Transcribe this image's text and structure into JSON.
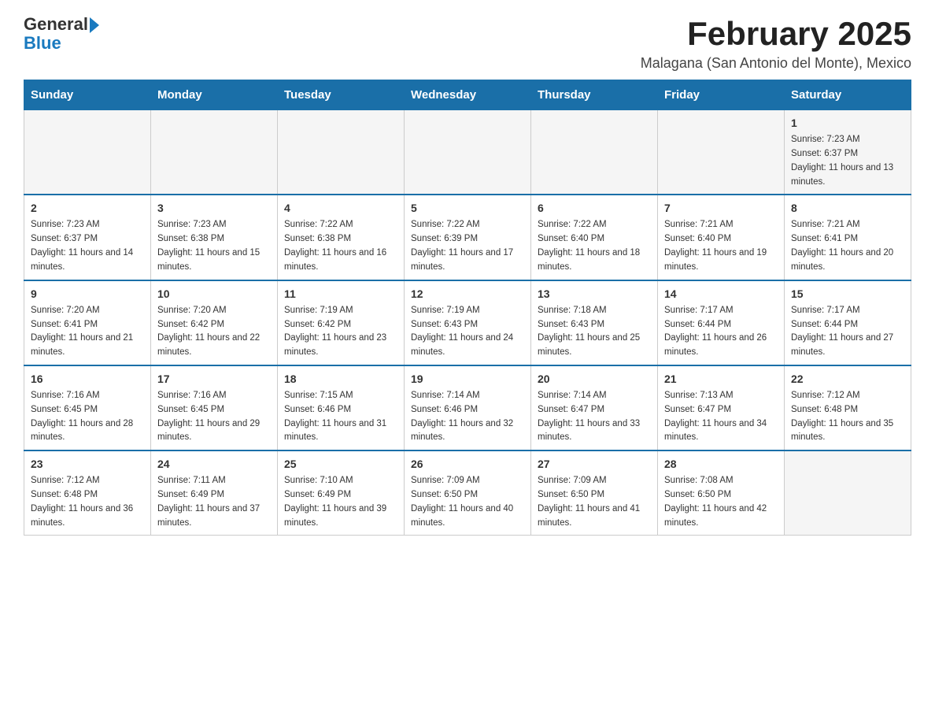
{
  "header": {
    "logo_general": "General",
    "logo_blue": "Blue",
    "month_title": "February 2025",
    "subtitle": "Malagana (San Antonio del Monte), Mexico"
  },
  "days_of_week": [
    "Sunday",
    "Monday",
    "Tuesday",
    "Wednesday",
    "Thursday",
    "Friday",
    "Saturday"
  ],
  "weeks": [
    {
      "days": [
        {
          "num": "",
          "info": ""
        },
        {
          "num": "",
          "info": ""
        },
        {
          "num": "",
          "info": ""
        },
        {
          "num": "",
          "info": ""
        },
        {
          "num": "",
          "info": ""
        },
        {
          "num": "",
          "info": ""
        },
        {
          "num": "1",
          "info": "Sunrise: 7:23 AM\nSunset: 6:37 PM\nDaylight: 11 hours and 13 minutes."
        }
      ]
    },
    {
      "days": [
        {
          "num": "2",
          "info": "Sunrise: 7:23 AM\nSunset: 6:37 PM\nDaylight: 11 hours and 14 minutes."
        },
        {
          "num": "3",
          "info": "Sunrise: 7:23 AM\nSunset: 6:38 PM\nDaylight: 11 hours and 15 minutes."
        },
        {
          "num": "4",
          "info": "Sunrise: 7:22 AM\nSunset: 6:38 PM\nDaylight: 11 hours and 16 minutes."
        },
        {
          "num": "5",
          "info": "Sunrise: 7:22 AM\nSunset: 6:39 PM\nDaylight: 11 hours and 17 minutes."
        },
        {
          "num": "6",
          "info": "Sunrise: 7:22 AM\nSunset: 6:40 PM\nDaylight: 11 hours and 18 minutes."
        },
        {
          "num": "7",
          "info": "Sunrise: 7:21 AM\nSunset: 6:40 PM\nDaylight: 11 hours and 19 minutes."
        },
        {
          "num": "8",
          "info": "Sunrise: 7:21 AM\nSunset: 6:41 PM\nDaylight: 11 hours and 20 minutes."
        }
      ]
    },
    {
      "days": [
        {
          "num": "9",
          "info": "Sunrise: 7:20 AM\nSunset: 6:41 PM\nDaylight: 11 hours and 21 minutes."
        },
        {
          "num": "10",
          "info": "Sunrise: 7:20 AM\nSunset: 6:42 PM\nDaylight: 11 hours and 22 minutes."
        },
        {
          "num": "11",
          "info": "Sunrise: 7:19 AM\nSunset: 6:42 PM\nDaylight: 11 hours and 23 minutes."
        },
        {
          "num": "12",
          "info": "Sunrise: 7:19 AM\nSunset: 6:43 PM\nDaylight: 11 hours and 24 minutes."
        },
        {
          "num": "13",
          "info": "Sunrise: 7:18 AM\nSunset: 6:43 PM\nDaylight: 11 hours and 25 minutes."
        },
        {
          "num": "14",
          "info": "Sunrise: 7:17 AM\nSunset: 6:44 PM\nDaylight: 11 hours and 26 minutes."
        },
        {
          "num": "15",
          "info": "Sunrise: 7:17 AM\nSunset: 6:44 PM\nDaylight: 11 hours and 27 minutes."
        }
      ]
    },
    {
      "days": [
        {
          "num": "16",
          "info": "Sunrise: 7:16 AM\nSunset: 6:45 PM\nDaylight: 11 hours and 28 minutes."
        },
        {
          "num": "17",
          "info": "Sunrise: 7:16 AM\nSunset: 6:45 PM\nDaylight: 11 hours and 29 minutes."
        },
        {
          "num": "18",
          "info": "Sunrise: 7:15 AM\nSunset: 6:46 PM\nDaylight: 11 hours and 31 minutes."
        },
        {
          "num": "19",
          "info": "Sunrise: 7:14 AM\nSunset: 6:46 PM\nDaylight: 11 hours and 32 minutes."
        },
        {
          "num": "20",
          "info": "Sunrise: 7:14 AM\nSunset: 6:47 PM\nDaylight: 11 hours and 33 minutes."
        },
        {
          "num": "21",
          "info": "Sunrise: 7:13 AM\nSunset: 6:47 PM\nDaylight: 11 hours and 34 minutes."
        },
        {
          "num": "22",
          "info": "Sunrise: 7:12 AM\nSunset: 6:48 PM\nDaylight: 11 hours and 35 minutes."
        }
      ]
    },
    {
      "days": [
        {
          "num": "23",
          "info": "Sunrise: 7:12 AM\nSunset: 6:48 PM\nDaylight: 11 hours and 36 minutes."
        },
        {
          "num": "24",
          "info": "Sunrise: 7:11 AM\nSunset: 6:49 PM\nDaylight: 11 hours and 37 minutes."
        },
        {
          "num": "25",
          "info": "Sunrise: 7:10 AM\nSunset: 6:49 PM\nDaylight: 11 hours and 39 minutes."
        },
        {
          "num": "26",
          "info": "Sunrise: 7:09 AM\nSunset: 6:50 PM\nDaylight: 11 hours and 40 minutes."
        },
        {
          "num": "27",
          "info": "Sunrise: 7:09 AM\nSunset: 6:50 PM\nDaylight: 11 hours and 41 minutes."
        },
        {
          "num": "28",
          "info": "Sunrise: 7:08 AM\nSunset: 6:50 PM\nDaylight: 11 hours and 42 minutes."
        },
        {
          "num": "",
          "info": ""
        }
      ]
    }
  ]
}
